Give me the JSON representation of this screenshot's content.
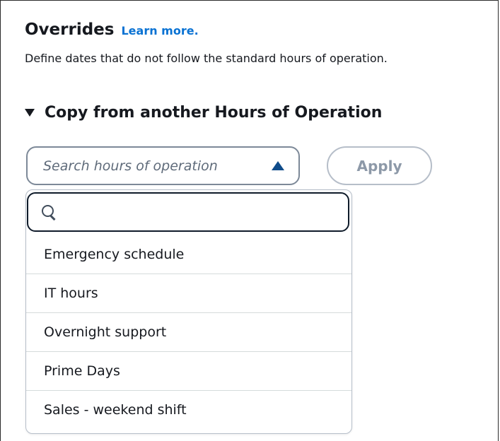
{
  "overrides": {
    "title": "Overrides",
    "learn_more": "Learn more.",
    "description": "Define dates that do not follow the standard hours of operation."
  },
  "copy_section": {
    "expanded_icon": "caret-down-icon",
    "title": "Copy from another Hours of Operation",
    "select": {
      "placeholder": "Search hours of operation",
      "expanded": true,
      "toggle_icon": "caret-up-icon"
    },
    "apply_label": "Apply",
    "apply_disabled": true
  },
  "dropdown": {
    "filter_icon": "search-icon",
    "filter_value": "",
    "options": [
      "Emergency schedule",
      "IT hours",
      "Overnight support",
      "Prime Days",
      "Sales - weekend shift"
    ]
  },
  "colors": {
    "link": "#0972d3",
    "text": "#16191f",
    "placeholder": "#5f6b7a",
    "disabled": "#8d99a8",
    "focus_border": "#0f1b2a",
    "caret_up": "#0f4c8a"
  }
}
